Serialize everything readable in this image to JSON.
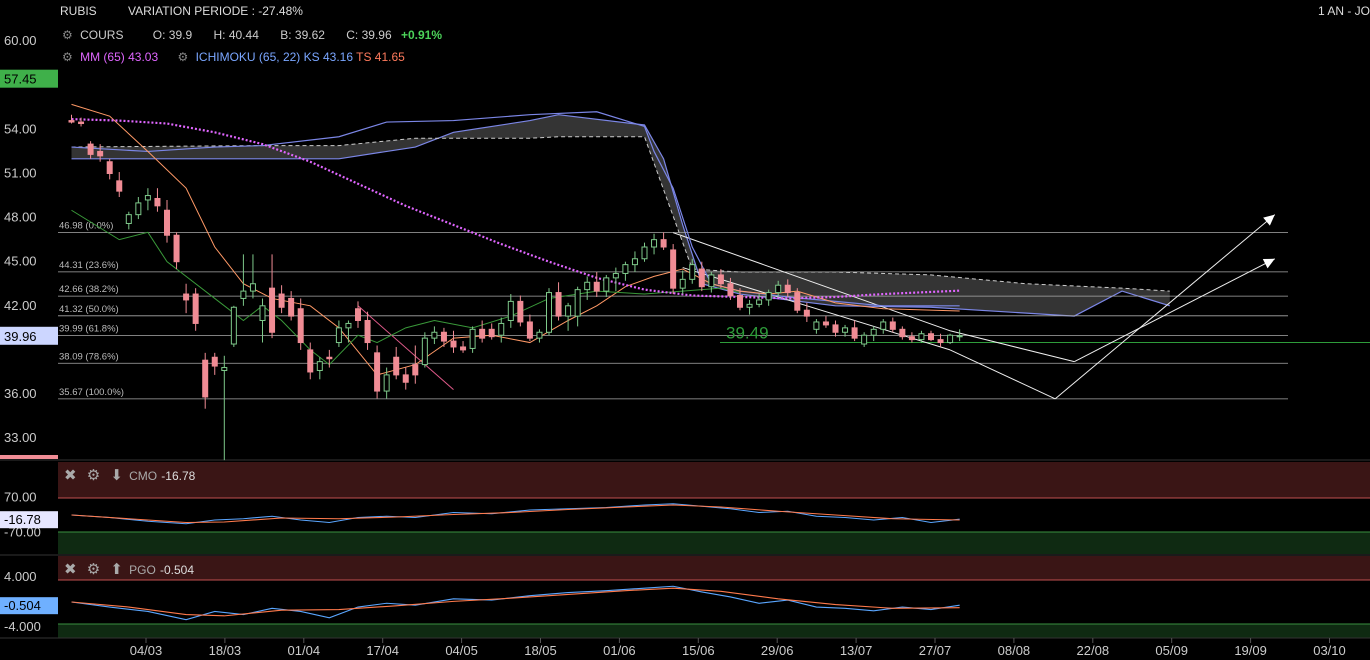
{
  "header": {
    "symbol": "RUBIS",
    "variation": "VARIATION PERIODE : -27.48%",
    "period": "1 AN - JO"
  },
  "quote": {
    "label": "COURS",
    "open": "O: 39.9",
    "high": "H: 40.44",
    "low": "B: 39.62",
    "close": "C: 39.96",
    "change": "+0.91%"
  },
  "indicators": {
    "mm": "MM (65) 43.03",
    "ichimoku": "ICHIMOKU (65, 22)",
    "ks": "KS 43.16",
    "ts": "TS 41.65"
  },
  "colors": {
    "up": "#7ec98a",
    "down": "#f08c95",
    "ma": "#e066ff",
    "ks": "#7b86e6",
    "ts": "#ff9966",
    "green_line": "#2e9c3a",
    "cloud": "#3a3a3a"
  },
  "price_axis": {
    "ticks": [
      "60.00",
      "54.00",
      "51.00",
      "48.00",
      "45.00",
      "42.00",
      "36.00",
      "33.00"
    ],
    "badge_high": "57.45",
    "badge_last": "39.96"
  },
  "fibonacci": [
    {
      "value": 46.98,
      "label": "46.98  (0.0%)"
    },
    {
      "value": 44.31,
      "label": "44.31  (23.6%)"
    },
    {
      "value": 42.66,
      "label": "42.66  (38.2%)"
    },
    {
      "value": 41.32,
      "label": "41.32  (50.0%)"
    },
    {
      "value": 39.99,
      "label": "39.99  (61.8%)"
    },
    {
      "value": 38.09,
      "label": "38.09  (78.6%)"
    },
    {
      "value": 35.67,
      "label": "35.67  (100.0%)"
    }
  ],
  "annotation": "39.49",
  "cmo": {
    "name": "CMO",
    "value": "-16.78",
    "ticks": [
      "70.00",
      "-70.00"
    ],
    "badge": "-16.78"
  },
  "pgo": {
    "name": "PGO",
    "value": "-0.504",
    "ticks": [
      "4.000",
      "-4.000"
    ],
    "badge": "-0.504"
  },
  "x_axis": {
    "labels": [
      "04/03",
      "18/03",
      "01/04",
      "17/04",
      "04/05",
      "18/05",
      "01/06",
      "15/06",
      "29/06",
      "13/07",
      "27/07",
      "08/08",
      "22/08",
      "05/09",
      "19/09",
      "03/10"
    ]
  },
  "chart_data": {
    "type": "candlestick",
    "ylim": [
      31.5,
      61
    ],
    "candles": [
      [
        54.6,
        55.0,
        54.4,
        54.5
      ],
      [
        54.5,
        54.8,
        54.2,
        54.4
      ],
      [
        53.0,
        53.2,
        52.0,
        52.3
      ],
      [
        52.5,
        53.0,
        51.8,
        52.2
      ],
      [
        51.8,
        52.0,
        50.6,
        51.0
      ],
      [
        50.5,
        51.1,
        49.4,
        49.8
      ],
      [
        47.6,
        48.4,
        47.2,
        48.2
      ],
      [
        48.2,
        49.4,
        47.9,
        49.0
      ],
      [
        49.2,
        50.0,
        48.5,
        49.5
      ],
      [
        49.3,
        50.0,
        48.4,
        48.8
      ],
      [
        48.5,
        49.2,
        46.3,
        46.8
      ],
      [
        46.8,
        47.0,
        44.5,
        45.0
      ],
      [
        42.8,
        43.5,
        41.5,
        42.4
      ],
      [
        42.8,
        43.2,
        40.3,
        40.8
      ],
      [
        38.3,
        38.8,
        35.0,
        35.8
      ],
      [
        38.5,
        38.8,
        37.3,
        37.9
      ],
      [
        37.6,
        38.6,
        31.5,
        37.8
      ],
      [
        39.4,
        42.0,
        39.2,
        41.9
      ],
      [
        42.5,
        45.5,
        42.0,
        43.0
      ],
      [
        43.0,
        45.5,
        42.5,
        43.5
      ],
      [
        41.0,
        42.5,
        39.5,
        42.0
      ],
      [
        43.2,
        45.5,
        39.8,
        40.2
      ],
      [
        42.8,
        43.4,
        41.5,
        41.9
      ],
      [
        42.5,
        43.0,
        41.0,
        41.3
      ],
      [
        41.8,
        42.5,
        39.0,
        39.5
      ],
      [
        39.0,
        39.5,
        37.0,
        37.5
      ],
      [
        37.6,
        38.5,
        37.0,
        38.2
      ],
      [
        38.5,
        39.0,
        37.8,
        38.4
      ],
      [
        39.5,
        41.0,
        39.2,
        40.5
      ],
      [
        40.5,
        41.0,
        39.5,
        40.8
      ],
      [
        41.8,
        42.3,
        40.5,
        41.0
      ],
      [
        41.0,
        41.6,
        39.0,
        39.5
      ],
      [
        38.8,
        39.3,
        35.7,
        36.2
      ],
      [
        36.2,
        37.8,
        35.7,
        37.3
      ],
      [
        38.5,
        39.2,
        37.0,
        37.3
      ],
      [
        37.3,
        37.8,
        36.3,
        36.8
      ],
      [
        38.0,
        39.3,
        36.7,
        37.3
      ],
      [
        38.0,
        40.2,
        37.8,
        39.8
      ],
      [
        39.8,
        40.6,
        39.4,
        40.2
      ],
      [
        40.2,
        40.5,
        39.2,
        39.6
      ],
      [
        39.6,
        40.3,
        38.8,
        39.2
      ],
      [
        39.2,
        39.6,
        38.8,
        39.0
      ],
      [
        39.1,
        40.6,
        38.8,
        40.4
      ],
      [
        40.4,
        41.0,
        39.5,
        39.8
      ],
      [
        40.4,
        40.8,
        39.7,
        39.9
      ],
      [
        40.0,
        41.2,
        39.5,
        40.8
      ],
      [
        41.0,
        42.8,
        40.5,
        42.3
      ],
      [
        42.3,
        42.7,
        40.6,
        40.9
      ],
      [
        40.9,
        41.4,
        39.6,
        39.8
      ],
      [
        39.8,
        40.4,
        39.5,
        40.2
      ],
      [
        40.2,
        43.2,
        40.0,
        42.9
      ],
      [
        42.9,
        43.6,
        41.0,
        41.3
      ],
      [
        41.3,
        42.2,
        40.3,
        42.0
      ],
      [
        41.3,
        43.3,
        40.6,
        43.1
      ],
      [
        43.1,
        44.0,
        42.4,
        43.6
      ],
      [
        43.6,
        44.3,
        42.6,
        43.0
      ],
      [
        43.0,
        44.1,
        42.6,
        43.9
      ],
      [
        43.9,
        44.6,
        43.0,
        44.2
      ],
      [
        44.2,
        45.0,
        43.7,
        44.8
      ],
      [
        44.8,
        45.7,
        44.3,
        45.2
      ],
      [
        45.2,
        46.3,
        45.0,
        46.0
      ],
      [
        46.0,
        46.9,
        45.5,
        46.5
      ],
      [
        46.5,
        47.0,
        45.8,
        46.0
      ],
      [
        45.8,
        46.2,
        42.8,
        43.2
      ],
      [
        43.2,
        44.4,
        42.8,
        43.8
      ],
      [
        43.8,
        45.2,
        43.5,
        44.8
      ],
      [
        44.5,
        45.0,
        43.0,
        43.3
      ],
      [
        43.3,
        44.3,
        42.9,
        44.1
      ],
      [
        44.1,
        44.5,
        43.2,
        43.5
      ],
      [
        43.5,
        43.9,
        42.4,
        42.7
      ],
      [
        42.7,
        43.2,
        41.7,
        41.9
      ],
      [
        41.9,
        42.4,
        41.4,
        42.1
      ],
      [
        42.1,
        42.8,
        41.9,
        42.4
      ],
      [
        42.4,
        43.1,
        42.0,
        42.9
      ],
      [
        42.9,
        43.7,
        42.6,
        43.4
      ],
      [
        43.4,
        43.8,
        42.6,
        42.9
      ],
      [
        42.9,
        43.2,
        41.5,
        41.7
      ],
      [
        41.7,
        42.2,
        40.9,
        41.3
      ],
      [
        40.4,
        41.1,
        40.1,
        40.9
      ],
      [
        40.9,
        41.3,
        40.5,
        40.7
      ],
      [
        40.7,
        41.0,
        39.9,
        40.2
      ],
      [
        40.2,
        40.7,
        39.9,
        40.5
      ],
      [
        40.5,
        41.0,
        39.6,
        39.8
      ],
      [
        39.4,
        40.2,
        39.2,
        40.0
      ],
      [
        40.0,
        40.6,
        39.6,
        40.4
      ],
      [
        40.4,
        41.1,
        40.1,
        40.9
      ],
      [
        40.9,
        41.2,
        40.2,
        40.4
      ],
      [
        40.4,
        40.6,
        39.7,
        39.9
      ],
      [
        39.9,
        40.2,
        39.5,
        39.7
      ],
      [
        39.7,
        40.3,
        39.5,
        40.1
      ],
      [
        40.1,
        40.3,
        39.6,
        39.7
      ],
      [
        39.7,
        40.1,
        39.2,
        39.5
      ],
      [
        39.5,
        40.1,
        39.4,
        40.0
      ],
      [
        39.9,
        40.4,
        39.6,
        39.96
      ]
    ],
    "ma65": [
      [
        0,
        54.7
      ],
      [
        5,
        54.6
      ],
      [
        10,
        54.4
      ],
      [
        15,
        53.8
      ],
      [
        20,
        53.0
      ],
      [
        25,
        51.8
      ],
      [
        30,
        50.3
      ],
      [
        35,
        48.8
      ],
      [
        40,
        47.5
      ],
      [
        45,
        46.2
      ],
      [
        50,
        45.0
      ],
      [
        55,
        43.9
      ],
      [
        60,
        43.1
      ],
      [
        65,
        42.7
      ],
      [
        70,
        42.6
      ],
      [
        75,
        42.5
      ],
      [
        80,
        42.6
      ],
      [
        85,
        42.8
      ],
      [
        93,
        43.03
      ]
    ],
    "kijun": [
      [
        0,
        52.8
      ],
      [
        8,
        52.5
      ],
      [
        15,
        52.8
      ],
      [
        20,
        52.9
      ],
      [
        28,
        53.5
      ],
      [
        33,
        54.5
      ],
      [
        40,
        54.6
      ],
      [
        48,
        55.0
      ],
      [
        55,
        55.2
      ],
      [
        60,
        54.2
      ],
      [
        61,
        52.5
      ],
      [
        63,
        50.0
      ],
      [
        65,
        46.0
      ],
      [
        67,
        43.5
      ],
      [
        70,
        43.0
      ],
      [
        75,
        42.6
      ],
      [
        80,
        42.3
      ],
      [
        85,
        42.0
      ],
      [
        93,
        42.0
      ]
    ],
    "tenkan": [
      [
        0,
        55.7
      ],
      [
        4,
        54.9
      ],
      [
        8,
        52.5
      ],
      [
        12,
        50.0
      ],
      [
        15,
        46.0
      ],
      [
        18,
        43.5
      ],
      [
        21,
        42.5
      ],
      [
        25,
        42.0
      ],
      [
        28,
        40.5
      ],
      [
        32,
        37.3
      ],
      [
        36,
        38.0
      ],
      [
        40,
        39.8
      ],
      [
        44,
        40.0
      ],
      [
        48,
        39.5
      ],
      [
        52,
        41.0
      ],
      [
        55,
        42.0
      ],
      [
        58,
        43.3
      ],
      [
        61,
        44.0
      ],
      [
        64,
        44.5
      ],
      [
        67,
        43.5
      ],
      [
        70,
        43.0
      ],
      [
        73,
        42.8
      ],
      [
        76,
        43.0
      ],
      [
        80,
        42.2
      ],
      [
        85,
        41.8
      ],
      [
        93,
        41.65
      ]
    ],
    "chikou": [
      [
        0,
        48.5
      ],
      [
        5,
        46.5
      ],
      [
        8,
        47.0
      ],
      [
        10,
        45.0
      ],
      [
        12,
        44.0
      ],
      [
        15,
        42.5
      ],
      [
        18,
        41.0
      ],
      [
        20,
        42.0
      ],
      [
        22,
        41.0
      ],
      [
        25,
        39.0
      ],
      [
        27,
        38.0
      ],
      [
        30,
        40.0
      ],
      [
        32,
        39.5
      ],
      [
        35,
        40.5
      ],
      [
        38,
        41.0
      ],
      [
        42,
        40.5
      ],
      [
        46,
        41.3
      ],
      [
        50,
        42.5
      ],
      [
        55,
        43.0
      ],
      [
        60,
        42.8
      ],
      [
        64,
        43.0
      ],
      [
        68,
        43.2
      ],
      [
        70,
        42.9
      ]
    ],
    "cloud_a": [
      [
        0,
        52.8
      ],
      [
        20,
        52.9
      ],
      [
        28,
        52.9
      ],
      [
        36,
        53.4
      ],
      [
        48,
        53.4
      ],
      [
        51,
        53.5
      ],
      [
        60,
        53.5
      ],
      [
        65,
        44.5
      ],
      [
        70,
        44.3
      ],
      [
        80,
        44.3
      ],
      [
        90,
        44.1
      ],
      [
        100,
        43.5
      ],
      [
        110,
        43.2
      ],
      [
        115,
        43.0
      ]
    ],
    "cloud_b": [
      [
        0,
        52.0
      ],
      [
        20,
        52.0
      ],
      [
        28,
        52.0
      ],
      [
        36,
        52.8
      ],
      [
        40,
        53.8
      ],
      [
        48,
        54.6
      ],
      [
        51,
        55.0
      ],
      [
        60,
        54.3
      ],
      [
        62,
        52.0
      ],
      [
        64,
        47.5
      ],
      [
        66,
        43.5
      ],
      [
        70,
        42.8
      ],
      [
        80,
        42.0
      ],
      [
        90,
        41.9
      ],
      [
        100,
        41.5
      ],
      [
        105,
        41.3
      ],
      [
        110,
        43.0
      ],
      [
        115,
        42.0
      ]
    ],
    "cmo": [
      [
        0,
        0
      ],
      [
        4,
        -10
      ],
      [
        8,
        -25
      ],
      [
        12,
        -35
      ],
      [
        15,
        -20
      ],
      [
        18,
        -15
      ],
      [
        21,
        -5
      ],
      [
        24,
        -20
      ],
      [
        27,
        -30
      ],
      [
        30,
        -10
      ],
      [
        33,
        -5
      ],
      [
        36,
        -10
      ],
      [
        40,
        10
      ],
      [
        44,
        5
      ],
      [
        48,
        20
      ],
      [
        52,
        25
      ],
      [
        56,
        30
      ],
      [
        60,
        40
      ],
      [
        63,
        45
      ],
      [
        66,
        35
      ],
      [
        69,
        25
      ],
      [
        72,
        10
      ],
      [
        75,
        15
      ],
      [
        78,
        -5
      ],
      [
        81,
        -10
      ],
      [
        84,
        -20
      ],
      [
        87,
        -10
      ],
      [
        90,
        -30
      ],
      [
        93,
        -16.78
      ]
    ],
    "cmo_signal": [
      [
        0,
        0
      ],
      [
        6,
        -15
      ],
      [
        12,
        -30
      ],
      [
        16,
        -28
      ],
      [
        22,
        -12
      ],
      [
        28,
        -15
      ],
      [
        34,
        -8
      ],
      [
        40,
        2
      ],
      [
        46,
        10
      ],
      [
        52,
        22
      ],
      [
        58,
        32
      ],
      [
        63,
        40
      ],
      [
        68,
        32
      ],
      [
        74,
        15
      ],
      [
        80,
        0
      ],
      [
        86,
        -15
      ],
      [
        93,
        -20
      ]
    ],
    "pgo": [
      [
        0,
        0
      ],
      [
        4,
        -0.8
      ],
      [
        8,
        -1.5
      ],
      [
        12,
        -2.8
      ],
      [
        15,
        -1.5
      ],
      [
        18,
        -2.0
      ],
      [
        21,
        -1.0
      ],
      [
        24,
        -1.5
      ],
      [
        27,
        -2.5
      ],
      [
        30,
        -0.8
      ],
      [
        33,
        -0.2
      ],
      [
        36,
        -0.5
      ],
      [
        40,
        0.5
      ],
      [
        44,
        0.3
      ],
      [
        48,
        1.0
      ],
      [
        52,
        1.5
      ],
      [
        56,
        1.8
      ],
      [
        60,
        2.2
      ],
      [
        63,
        2.5
      ],
      [
        66,
        1.6
      ],
      [
        69,
        0.8
      ],
      [
        72,
        -0.2
      ],
      [
        75,
        0.3
      ],
      [
        78,
        -0.8
      ],
      [
        81,
        -1.0
      ],
      [
        84,
        -1.4
      ],
      [
        87,
        -0.8
      ],
      [
        90,
        -1.2
      ],
      [
        93,
        -0.504
      ]
    ],
    "pgo_signal": [
      [
        0,
        0
      ],
      [
        6,
        -0.8
      ],
      [
        12,
        -2.0
      ],
      [
        16,
        -2.2
      ],
      [
        22,
        -1.3
      ],
      [
        28,
        -1.2
      ],
      [
        34,
        -0.6
      ],
      [
        40,
        0.1
      ],
      [
        46,
        0.6
      ],
      [
        52,
        1.2
      ],
      [
        58,
        1.8
      ],
      [
        63,
        2.2
      ],
      [
        68,
        1.7
      ],
      [
        74,
        0.5
      ],
      [
        80,
        -0.4
      ],
      [
        86,
        -1.0
      ],
      [
        93,
        -0.9
      ]
    ],
    "trendlines": [
      {
        "from": [
          63,
          46.98
        ],
        "to": [
          92,
          40.3
        ]
      },
      {
        "from": [
          64,
          44.6
        ],
        "to": [
          92,
          39.0
        ]
      },
      {
        "from": [
          30,
          42.0
        ],
        "to": [
          40,
          36.3
        ]
      },
      {
        "from": [
          92,
          40.3
        ],
        "to": [
          105,
          38.2
        ]
      },
      {
        "from": [
          92,
          39.0
        ],
        "to": [
          103,
          35.67
        ]
      },
      {
        "from": [
          105,
          38.2
        ],
        "to": [
          126,
          45.2
        ]
      },
      {
        "from": [
          103,
          35.67
        ],
        "to": [
          126,
          48.2
        ]
      }
    ]
  }
}
